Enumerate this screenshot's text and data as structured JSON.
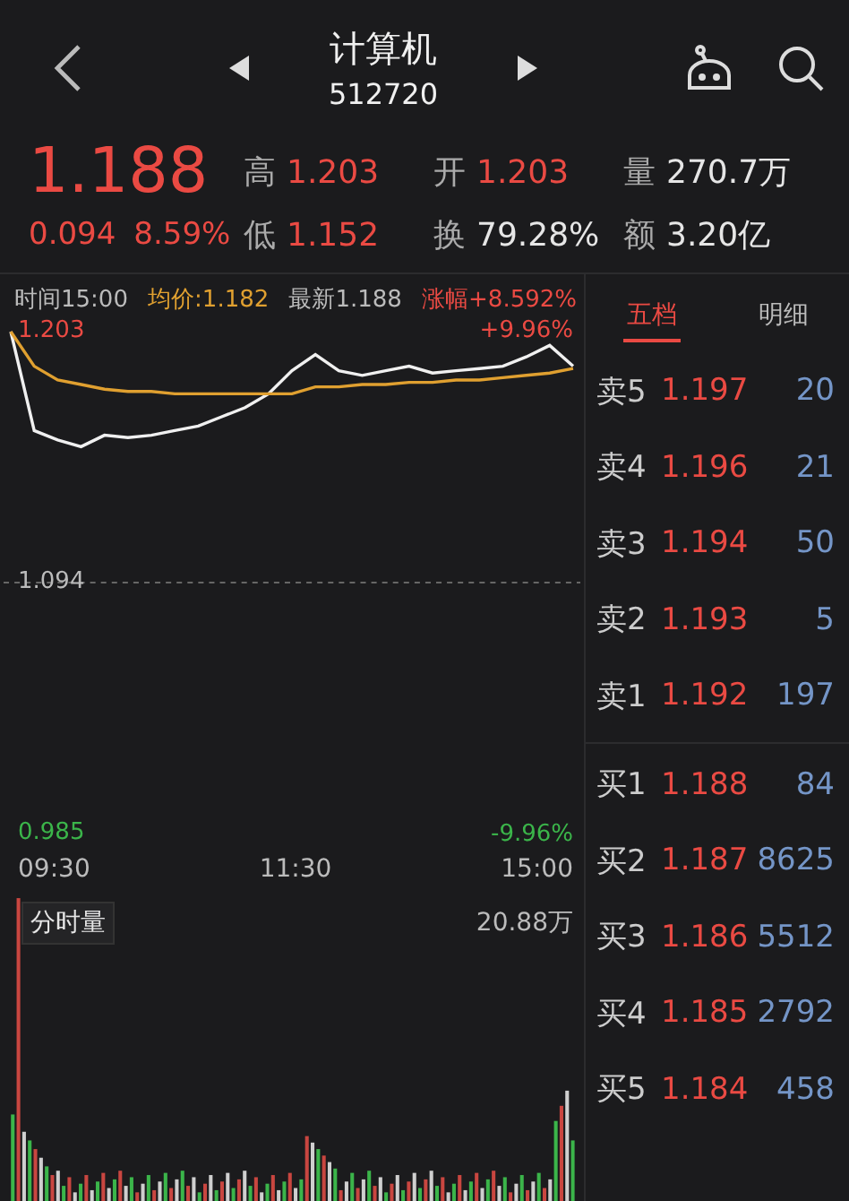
{
  "header": {
    "title": "计算机",
    "code": "512720"
  },
  "quote": {
    "price": "1.188",
    "change": "0.094",
    "change_pct": "8.59%",
    "stats": [
      {
        "label": "高",
        "value": "1.203",
        "color": "#ea4a43"
      },
      {
        "label": "开",
        "value": "1.203",
        "color": "#ea4a43"
      },
      {
        "label": "量",
        "value": "270.7万",
        "color": "#e6e6e6"
      },
      {
        "label": "低",
        "value": "1.152",
        "color": "#ea4a43"
      },
      {
        "label": "换",
        "value": "79.28%",
        "color": "#e6e6e6"
      },
      {
        "label": "额",
        "value": "3.20亿",
        "color": "#e6e6e6"
      }
    ]
  },
  "chart": {
    "time": "时间15:00",
    "avg": "均价:1.182",
    "latest": "最新1.188",
    "rise": "涨幅+8.592%",
    "high_pct": "+9.96%",
    "low_pct": "-9.96%",
    "volume_label": "分时量",
    "volume_max": "20.88万",
    "times": [
      "09:30",
      "11:30",
      "15:00"
    ],
    "chart_data": {
      "type": "line",
      "ylim": [
        0.985,
        1.203
      ],
      "yticks": [
        {
          "value": 0.985,
          "label": "0.985"
        },
        {
          "value": 1.094,
          "label": "1.094"
        },
        {
          "value": 1.203,
          "label": "1.203"
        }
      ],
      "series": [
        {
          "color": "#f0f0f0",
          "values": [
            1.203,
            1.16,
            1.156,
            1.153,
            1.158,
            1.157,
            1.158,
            1.16,
            1.162,
            1.166,
            1.17,
            1.176,
            1.186,
            1.193,
            1.186,
            1.184,
            1.186,
            1.188,
            1.185,
            1.186,
            1.187,
            1.188,
            1.192,
            1.197,
            1.188
          ]
        },
        {
          "color": "#e0a030",
          "values": [
            1.203,
            1.188,
            1.182,
            1.18,
            1.178,
            1.177,
            1.177,
            1.176,
            1.176,
            1.176,
            1.176,
            1.176,
            1.176,
            1.179,
            1.179,
            1.18,
            1.18,
            1.181,
            1.181,
            1.182,
            1.182,
            1.183,
            1.184,
            1.185,
            1.187
          ]
        }
      ]
    }
  },
  "order_book": {
    "tabs": [
      {
        "label": "五档",
        "selected": true
      },
      {
        "label": "明细",
        "selected": false
      }
    ],
    "asks": [
      {
        "label": "卖5",
        "price": "1.197",
        "volume": "20"
      },
      {
        "label": "卖4",
        "price": "1.196",
        "volume": "21"
      },
      {
        "label": "卖3",
        "price": "1.194",
        "volume": "50"
      },
      {
        "label": "卖2",
        "price": "1.193",
        "volume": "5"
      },
      {
        "label": "卖1",
        "price": "1.192",
        "volume": "197"
      }
    ],
    "bids": [
      {
        "label": "买1",
        "price": "1.188",
        "volume": "84"
      },
      {
        "label": "买2",
        "price": "1.187",
        "volume": "8625"
      },
      {
        "label": "买3",
        "price": "1.186",
        "volume": "5512"
      },
      {
        "label": "买4",
        "price": "1.185",
        "volume": "2792"
      },
      {
        "label": "买5",
        "price": "1.184",
        "volume": "458"
      }
    ]
  }
}
